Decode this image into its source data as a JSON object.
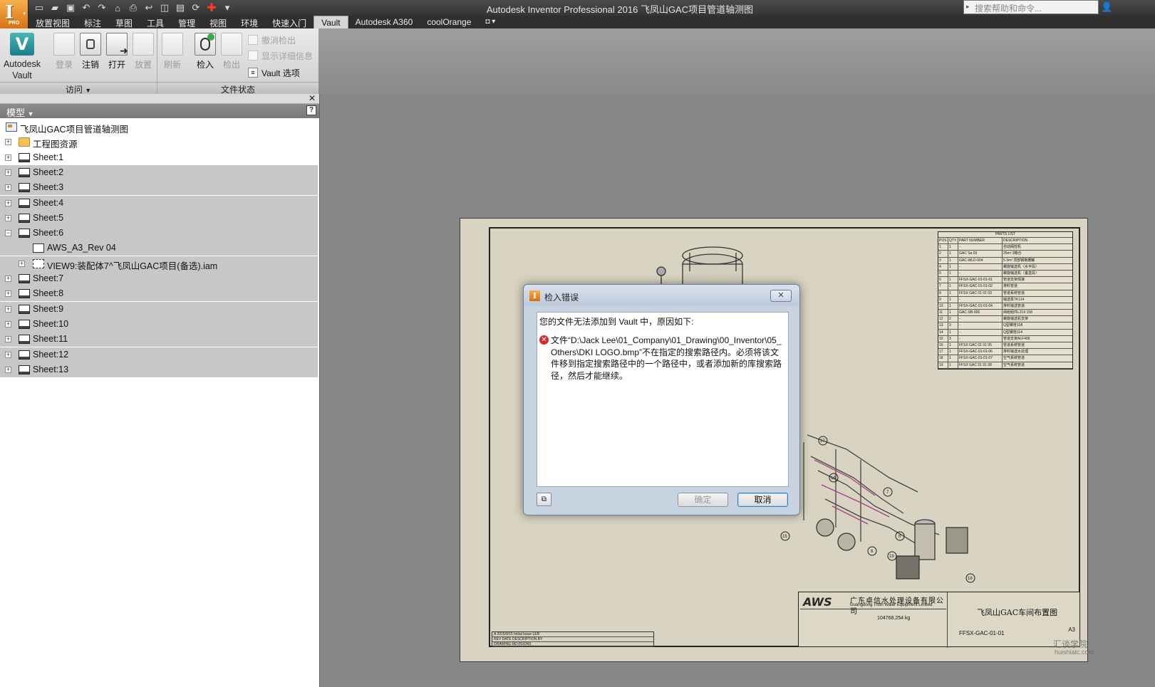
{
  "app": {
    "window_title": "Autodesk Inventor Professional 2016    飞凤山GAC项目管道轴测图",
    "app_badge": "PRO",
    "help_search_placeholder": "搜索帮助和命令..."
  },
  "ribbon": {
    "tabs": [
      {
        "label": "放置视图"
      },
      {
        "label": "标注"
      },
      {
        "label": "草图"
      },
      {
        "label": "工具"
      },
      {
        "label": "管理"
      },
      {
        "label": "视图"
      },
      {
        "label": "环境"
      },
      {
        "label": "快速入门"
      },
      {
        "label": "Vault",
        "active": true
      },
      {
        "label": "Autodesk A360"
      },
      {
        "label": "coolOrange"
      }
    ],
    "vault_button": {
      "line1": "Autodesk",
      "line2": "Vault"
    },
    "access_group": {
      "label": "访问",
      "buttons": [
        {
          "label": "登录",
          "enabled": false
        },
        {
          "label": "注销",
          "enabled": true
        },
        {
          "label": "打开",
          "enabled": true
        },
        {
          "label": "放置",
          "enabled": false
        }
      ]
    },
    "file_status_group": {
      "label": "文件状态",
      "buttons": [
        {
          "label": "刷新",
          "enabled": false
        },
        {
          "label": "检入",
          "enabled": true
        },
        {
          "label": "检出",
          "enabled": false
        }
      ],
      "small_buttons": [
        {
          "label": "撤消检出",
          "enabled": false
        },
        {
          "label": "显示详细信息",
          "enabled": false
        },
        {
          "label": "Vault 选项",
          "enabled": true
        }
      ]
    }
  },
  "browser": {
    "title": "模型",
    "help": "?",
    "tree": [
      {
        "label": "飞凤山GAC项目管道轴测图",
        "level": 0,
        "icon": "document-icon",
        "expander": "",
        "selected": false
      },
      {
        "label": "工程图资源",
        "level": 1,
        "icon": "folder-icon",
        "expander": "+",
        "selected": false
      },
      {
        "label": "Sheet:1",
        "level": 1,
        "icon": "sheet-icon",
        "expander": "+",
        "selected": false
      },
      {
        "label": "Sheet:2",
        "level": 1,
        "icon": "sheet-icon",
        "expander": "+",
        "selected": true
      },
      {
        "label": "Sheet:3",
        "level": 1,
        "icon": "sheet-icon",
        "expander": "+",
        "selected": true
      },
      {
        "label": "Sheet:4",
        "level": 1,
        "icon": "sheet-icon",
        "expander": "+",
        "selected": true
      },
      {
        "label": "Sheet:5",
        "level": 1,
        "icon": "sheet-icon",
        "expander": "+",
        "selected": true
      },
      {
        "label": "Sheet:6",
        "level": 1,
        "icon": "sheet-icon",
        "expander": "−",
        "selected": true
      },
      {
        "label": "AWS_A3_Rev 04",
        "level": 2,
        "icon": "border-icon",
        "expander": "",
        "selected": true
      },
      {
        "label": "VIEW9:装配体7^飞凤山GAC项目(备选).iam",
        "level": 2,
        "icon": "view-icon",
        "expander": "+",
        "selected": true
      },
      {
        "label": "Sheet:7",
        "level": 1,
        "icon": "sheet-icon",
        "expander": "+",
        "selected": true
      },
      {
        "label": "Sheet:8",
        "level": 1,
        "icon": "sheet-icon",
        "expander": "+",
        "selected": true
      },
      {
        "label": "Sheet:9",
        "level": 1,
        "icon": "sheet-icon",
        "expander": "+",
        "selected": true
      },
      {
        "label": "Sheet:10",
        "level": 1,
        "icon": "sheet-icon",
        "expander": "+",
        "selected": true
      },
      {
        "label": "Sheet:11",
        "level": 1,
        "icon": "sheet-icon",
        "expander": "+",
        "selected": true
      },
      {
        "label": "Sheet:12",
        "level": 1,
        "icon": "sheet-icon",
        "expander": "+",
        "selected": true
      },
      {
        "label": "Sheet:13",
        "level": 1,
        "icon": "sheet-icon",
        "expander": "+",
        "selected": true
      }
    ]
  },
  "drawing": {
    "parts_list_title": "PARTS LIST",
    "parts_list_headers": [
      "POS",
      "QTY.",
      "PART NUMBER",
      "DESCRIPTION"
    ],
    "parts_rows": [
      [
        "1",
        "1",
        "-",
        "自动阀控机"
      ],
      [
        "2",
        "1",
        "GAC Sa 03",
        "25m³ 3格仓"
      ],
      [
        "3",
        "1",
        "GAC-WLD-004",
        "5.3m³ 顶部钢格栅罐"
      ],
      [
        "4",
        "1",
        "-",
        "螺旋输送机（水平段）"
      ],
      [
        "5",
        "1",
        "-",
        "螺旋输送机（垂直段）"
      ],
      [
        "6",
        "1",
        "FFSX-GAC-01-01-01",
        "管道支架焊接"
      ],
      [
        "7",
        "1",
        "FFSX-GAC-01-01-02",
        "排料管道"
      ],
      [
        "8",
        "1",
        "FFSX GAC 01 01 03",
        "管道系统管道"
      ],
      [
        "9",
        "1",
        "-",
        "输送泵TK114"
      ],
      [
        "10",
        "1",
        "FFSX-GAC-01-01-04",
        "排料输送管道"
      ],
      [
        "11",
        "1",
        "GAC-SB-006",
        "阀组组件L219 158"
      ],
      [
        "12",
        "2",
        "-",
        "螺旋输送机支架"
      ],
      [
        "13",
        "3",
        "-",
        "Q型螺栓108"
      ],
      [
        "14",
        "1",
        "-",
        "Q型螺栓114"
      ],
      [
        "15",
        "3",
        "-",
        "管道支架ALF405"
      ],
      [
        "16",
        "1",
        "FFSX GAC 01 01 05",
        "管道系统管道"
      ],
      [
        "17",
        "1",
        "FFSX-GAC-01-01-06",
        "排料输送水处理"
      ],
      [
        "18",
        "1",
        "FFSX-GAC-01-01-07",
        "空气系统管道"
      ],
      [
        "19",
        "1",
        "FFSX GAC 01 01 08",
        "空气系统管道"
      ]
    ],
    "company_logo": "AWS",
    "company_cn": "广东卓信水处理设备有限公司",
    "company_en": "Guangdong Troth Water Equipment Limited",
    "weight": "104768.254 kg",
    "drawing_name": "飞凤山GAC车间布置图",
    "drawing_number": "FFSX-GAC-01-01",
    "sheet_size": "A3",
    "revision_rows": [
      "A   2015/9/15   Initial Issue                LER",
      "REV   DATE        DESCRIPTION            BY",
      "DRAWING REVISIONS"
    ],
    "balloon_numbers": [
      "17",
      "16",
      "7",
      "8",
      "6",
      "15",
      "19",
      "18"
    ]
  },
  "watermark": {
    "line1": "汇谈学院",
    "line2": "huishiatc.com"
  },
  "dialog": {
    "title": "检入错误",
    "message": "您的文件无法添加到 Vault 中，原因如下:",
    "detail": "文件“D:\\Jack Lee\\01_Company\\01_Drawing\\00_Inventor\\05_Others\\DKI LOGO.bmp”不在指定的搜索路径内。必须将该文件移到指定搜索路径中的一个路径中，或者添加新的库搜索路径，然后才能继续。",
    "ok_label": "确定",
    "cancel_label": "取消",
    "close_glyph": "✕"
  }
}
